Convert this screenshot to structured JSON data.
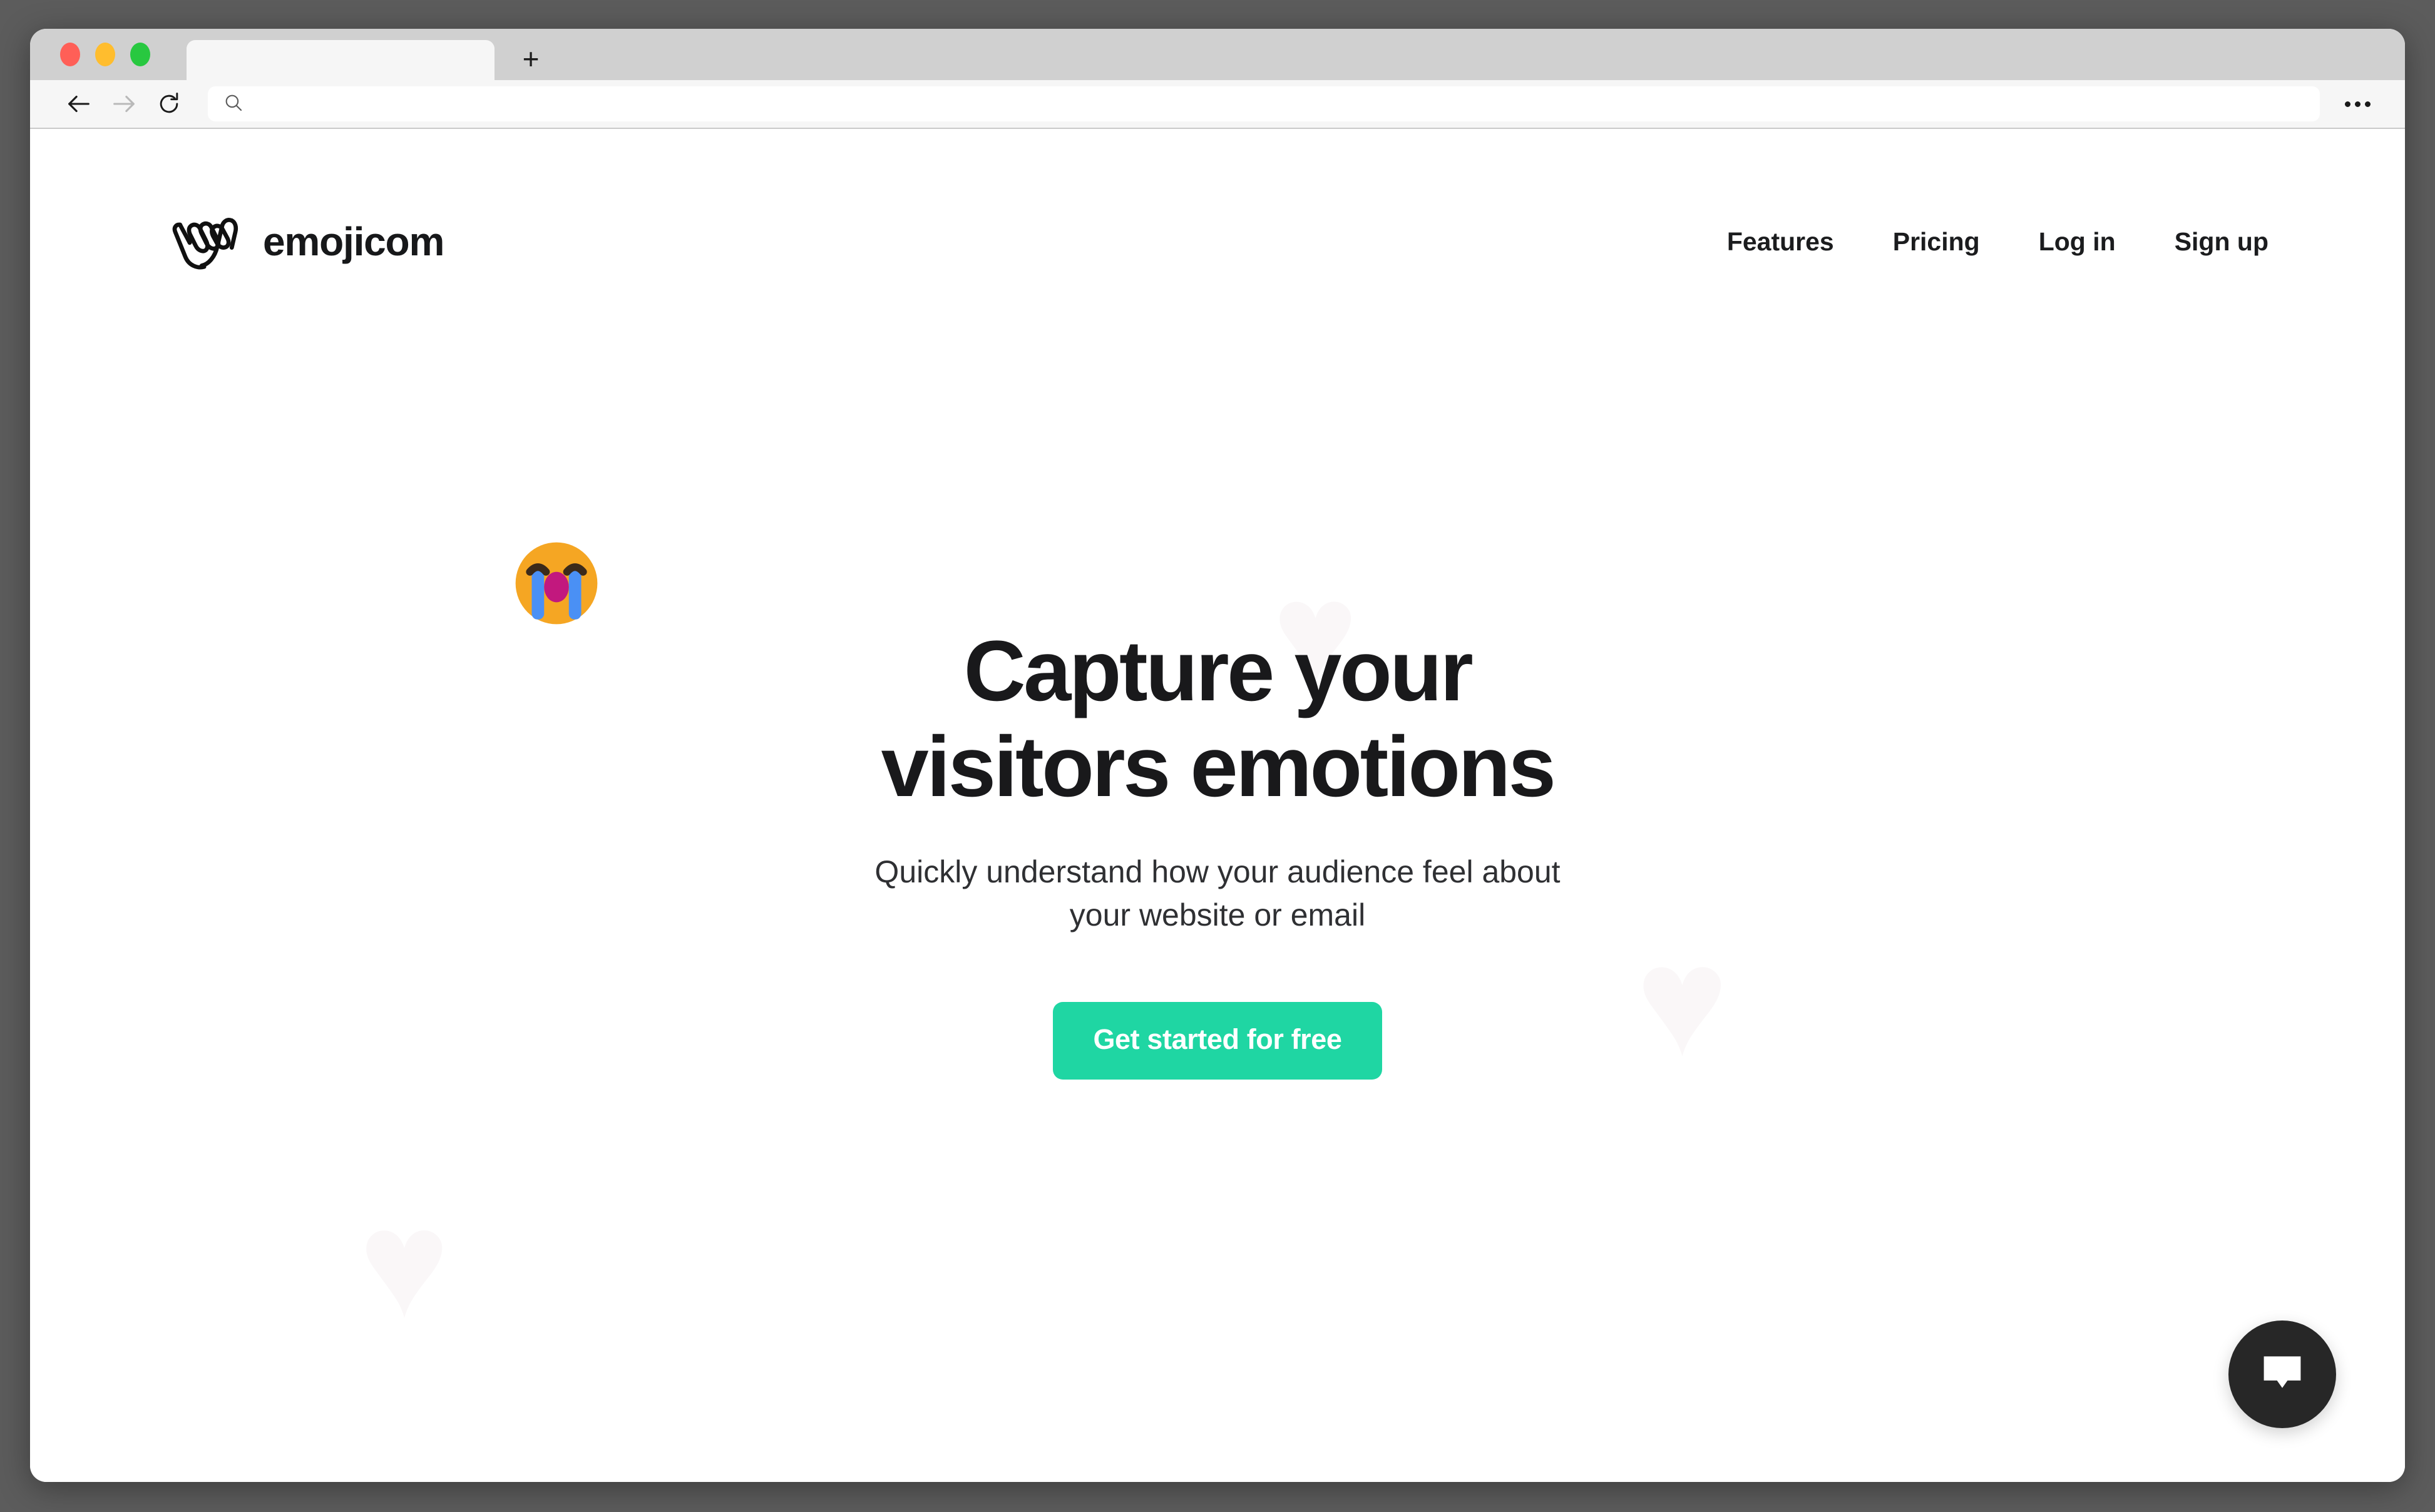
{
  "browser": {
    "traffic_lights": [
      "close",
      "minimize",
      "maximize"
    ],
    "tab_title": "",
    "new_tab_label": "+",
    "back_icon": "back-arrow-icon",
    "forward_icon": "forward-arrow-icon",
    "reload_icon": "reload-icon",
    "address_placeholder": "",
    "address_value": "",
    "search_icon": "search-icon",
    "more_label": "more-options-icon"
  },
  "site": {
    "brand": {
      "logo_icon": "shaka-hand-icon",
      "name": "emojicom"
    },
    "nav": [
      {
        "label": "Features"
      },
      {
        "label": "Pricing"
      },
      {
        "label": "Log in"
      },
      {
        "label": "Sign up"
      }
    ],
    "hero": {
      "title_line1": "Capture your",
      "title_line2": "visitors emotions",
      "subtitle_line1": "Quickly understand how your audience feel about",
      "subtitle_line2": "your website or email",
      "cta_label": "Get started for free",
      "emoji": "loudly-crying-face"
    },
    "watermarks": [
      {
        "name": "heart",
        "glyph": "♥"
      },
      {
        "name": "heart",
        "glyph": "♥"
      },
      {
        "name": "heart",
        "glyph": "♥"
      }
    ],
    "chat": {
      "icon": "chat-bubble-icon"
    }
  },
  "colors": {
    "accent": "#1fd6a3",
    "text": "#19191b",
    "chat_bg": "#272727",
    "emoji_face": "#f5a623",
    "emoji_tear": "#4a90f5",
    "emoji_mouth": "#c2187e",
    "desktop_bg": "#5c5c5c",
    "tabstrip_bg": "#d0d0d0",
    "toolbar_bg": "#f6f6f6"
  }
}
